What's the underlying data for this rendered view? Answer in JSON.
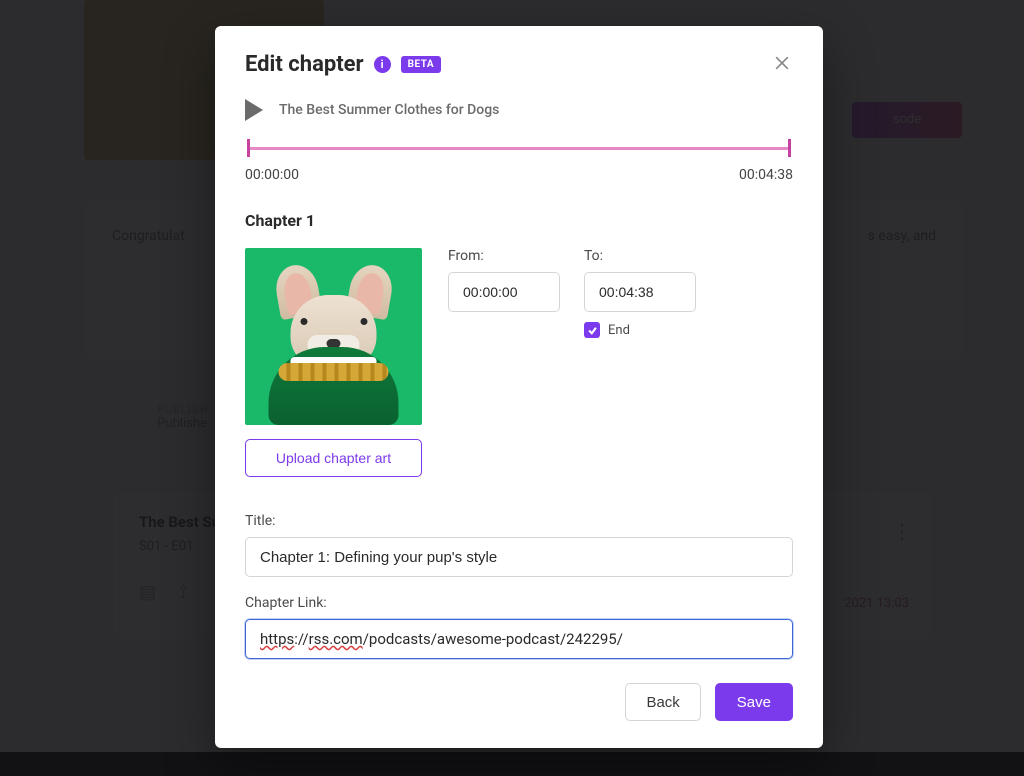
{
  "background": {
    "pill_button": "sode",
    "congrats_text": "Congratulat",
    "congrats_tail": "s easy, and",
    "publish_label": "PUBLISH",
    "publish_sub": "Publishe",
    "episode_title": "The Best Su",
    "episode_meta": "S01 - E01",
    "episode_date": "2021 13:03"
  },
  "modal": {
    "title": "Edit chapter",
    "beta": "BETA",
    "track_name": "The Best Summer Clothes for Dogs",
    "time_start": "00:00:00",
    "time_end": "00:04:38",
    "chapter_heading": "Chapter 1",
    "from_label": "From:",
    "to_label": "To:",
    "from_value": "00:00:00",
    "to_value": "00:04:38",
    "end_label": "End",
    "upload_label": "Upload chapter art",
    "title_label": "Title:",
    "title_value": "Chapter 1: Defining your pup's style",
    "link_label": "Chapter Link:",
    "link": {
      "p1": "https",
      "p2": "://",
      "p3": "rss.com",
      "p4": "/podcasts/awesome-podcast/242295/"
    },
    "back": "Back",
    "save": "Save"
  }
}
